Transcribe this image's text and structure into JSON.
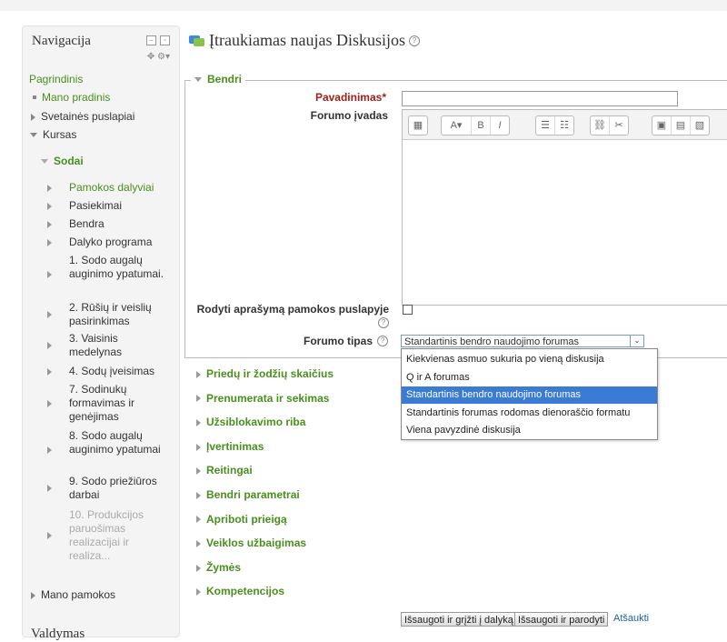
{
  "navigation": {
    "title": "Navigacija",
    "home": "Pagrindinis",
    "my_home": "Mano pradinis",
    "site_pages": "Svetainės puslapiai",
    "course": "Kursas",
    "course_name": "Sodai",
    "sections": [
      {
        "label": "Pamokos dalyviai",
        "link": true
      },
      {
        "label": "Pasiekimai"
      },
      {
        "label": "Bendra"
      },
      {
        "label": "Dalyko programa"
      },
      {
        "label": "1. Sodo augalų auginimo ypatumai."
      },
      {
        "label": "2. Rūšių ir veislių pasirinkimas"
      },
      {
        "label": "3. Vaisinis medelynas"
      },
      {
        "label": "4. Sodų įveisimas"
      },
      {
        "label": "7. Sodinukų formavimas ir genėjimas"
      },
      {
        "label": "8. Sodo augalų auginimo ypatumai"
      },
      {
        "label": "9. Sodo priežiūros darbai"
      },
      {
        "label": "10. Produkcijos paruošimas realizacijai ir realiza...",
        "dim": true
      }
    ],
    "my_courses": "Mano pamokos"
  },
  "second_block_title": "Valdymas",
  "page": {
    "title": "Įtraukiamas naujas Diskusijos",
    "legend": "Bendri",
    "name_label": "Pavadinimas",
    "name_value": "",
    "intro_label": "Forumo įvadas",
    "show_desc_label": "Rodyti aprašymą pamokos puslapyje",
    "forum_type_label": "Forumo tipas",
    "forum_type_value": "Standartinis bendro naudojimo forumas",
    "options": [
      "Kiekvienas asmuo sukuria po vieną diskusija",
      "Q ir A forumas",
      "Standartinis bendro naudojimo forumas",
      "Standartinis forumas rodomas dienoraščio formatu",
      "Viena pavyzdinė diskusija"
    ],
    "selected_option_index": 2,
    "sections": [
      "Priedų ir žodžių skaičius",
      "Prenumerata ir sekimas",
      "Užsiblokavimo riba",
      "Įvertinimas",
      "Reitingai",
      "Bendri parametrai",
      "Apriboti prieigą",
      "Veiklos užbaigimas",
      "Žymės",
      "Kompetencijos"
    ],
    "buttons": {
      "save_return": "Išsaugoti ir grįžti į dalyką",
      "save_display": "Išsaugoti ir parodyti",
      "cancel": "Atšaukti"
    }
  },
  "colors": {
    "link": "#4a8f1e",
    "required": "#a0201c",
    "selected": "#3a7bd5"
  }
}
